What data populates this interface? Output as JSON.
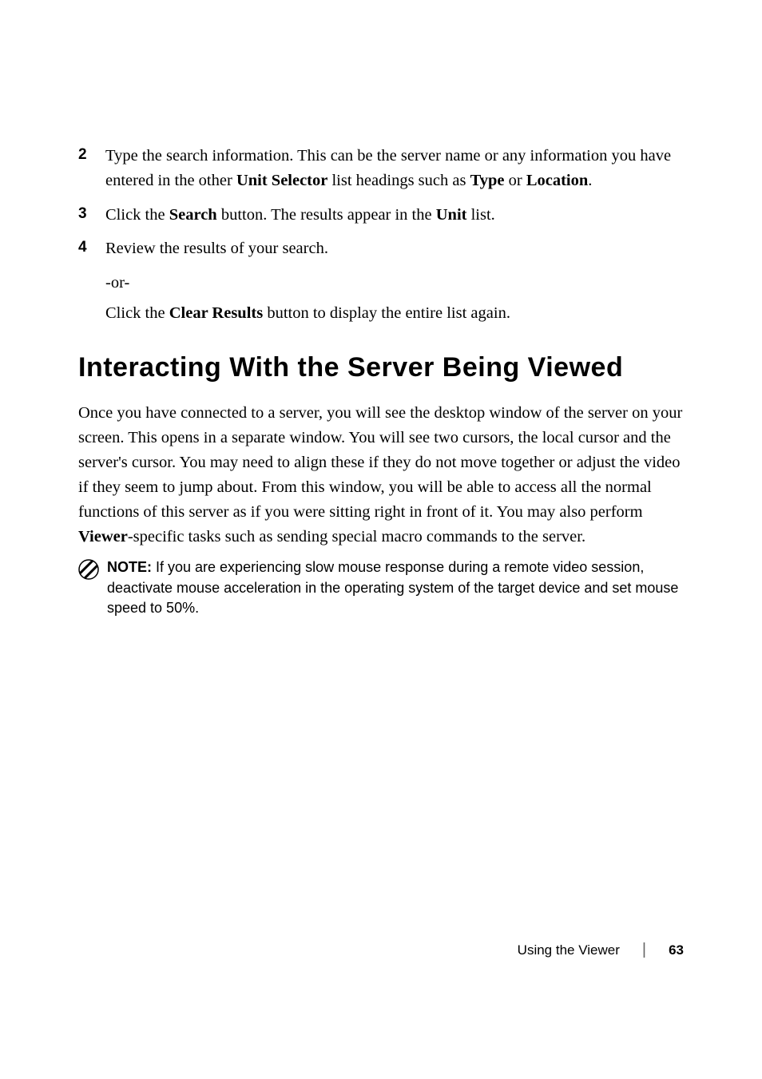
{
  "items": [
    {
      "number": "2",
      "text_before": "Type the search information. This can be the server name or any information you have entered in the other ",
      "bold1": "Unit Selector",
      "text_mid1": " list headings such as ",
      "bold2": "Type",
      "text_mid2": " or ",
      "bold3": "Location",
      "text_after": "."
    },
    {
      "number": "3",
      "text_before": "Click the ",
      "bold1": "Search",
      "text_mid1": " button. The results appear in the ",
      "bold2": "Unit",
      "text_after": " list."
    },
    {
      "number": "4",
      "text_before": "Review the results of your search."
    }
  ],
  "continuation": {
    "or": "-or-",
    "text_before": "Click the ",
    "bold1": "Clear Results",
    "text_after": " button to display the entire list again."
  },
  "heading": "Interacting With the Server Being Viewed",
  "paragraph": {
    "text_before": "Once you have connected to a server, you will see the desktop window of the server on your screen. This opens in a separate window. You will see two cursors, the local cursor and the server's cursor. You may need to align these if they do not move together or adjust the video if they seem to jump about. From this window, you will be able to access all the normal functions of this server as if you were sitting right in front of it. You may also perform ",
    "bold1": "Viewer",
    "text_after": "-specific tasks such as sending special macro commands to the server."
  },
  "note": {
    "label": "NOTE:",
    "text": " If you are experiencing slow mouse response during a remote video session, deactivate mouse acceleration in the operating system of the target device and set mouse speed to 50%."
  },
  "footer": {
    "title": "Using the Viewer",
    "page": "63"
  }
}
